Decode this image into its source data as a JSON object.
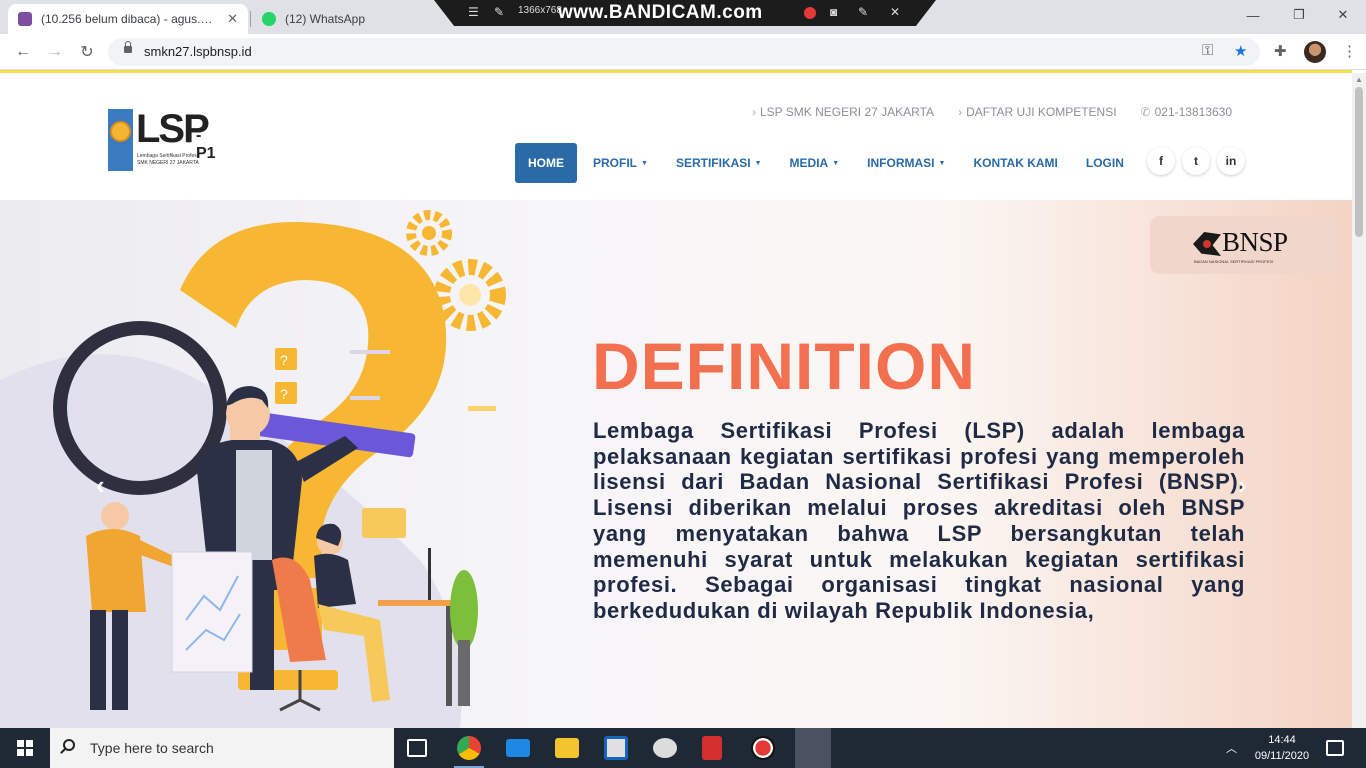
{
  "browser": {
    "tabs": [
      {
        "title": "(10.256 belum dibaca) - agus.sa:",
        "favicon_color": "#7b4ea3"
      },
      {
        "title": "(12) WhatsApp",
        "favicon_color": "#25d366"
      }
    ],
    "url": "smkn27.lspbnsp.id",
    "tab_close": "✕",
    "window_minimize": "—",
    "window_restore": "❐",
    "window_close": "✕"
  },
  "recorder": {
    "brand": "www.BANDICAM.com",
    "resolution": "1366x768"
  },
  "site": {
    "logo": {
      "main": "LSP",
      "suffix": "-P1",
      "line1": "Lembaga Sertifikasi Profesi",
      "line2": "SMK NEGERI 27 JAKARTA"
    },
    "top_links": [
      {
        "label": "LSP SMK NEGERI 27 JAKARTA",
        "icon": "chevron-right-icon"
      },
      {
        "label": "DAFTAR UJI KOMPETENSI",
        "icon": "chevron-right-icon"
      },
      {
        "label": "021-13813630",
        "icon": "phone-icon"
      }
    ],
    "nav": [
      {
        "label": "HOME",
        "dropdown": false,
        "active": true
      },
      {
        "label": "PROFIL",
        "dropdown": true
      },
      {
        "label": "SERTIFIKASI",
        "dropdown": true
      },
      {
        "label": "MEDIA",
        "dropdown": true
      },
      {
        "label": "INFORMASI",
        "dropdown": true
      },
      {
        "label": "KONTAK KAMI",
        "dropdown": false
      },
      {
        "label": "LOGIN",
        "dropdown": false
      }
    ],
    "social": [
      {
        "label": "f",
        "icon": "facebook-icon"
      },
      {
        "label": "t",
        "icon": "twitter-icon"
      },
      {
        "label": "in",
        "icon": "linkedin-icon"
      }
    ],
    "hero": {
      "badge_word": "BNSP",
      "badge_tagline": "BADAN NASIONAL SERTIFIKASI PROFESI",
      "title": "DEFINITION",
      "body": "Lembaga Sertifikasi Profesi (LSP) adalah lembaga pelaksanaan kegiatan sertifikasi profesi yang memperoleh lisensi dari Badan Nasional Sertifikasi Profesi (BNSP). Lisensi diberikan melalui proses akreditasi oleh BNSP yang menyatakan bahwa LSP bersangkutan telah memenuhi syarat untuk melakukan kegiatan sertifikasi profesi. Sebagai organisasi tingkat nasional yang berkedudukan di wilayah Republik Indonesia,",
      "prev_arrow": "‹",
      "next_arrow": "›"
    }
  },
  "taskbar": {
    "search_placeholder": "Type here to search",
    "time": "14:44",
    "date": "09/11/2020"
  },
  "colors": {
    "nav_blue": "#2a6aa6",
    "title_orange": "#f2704f",
    "body_navy": "#1f2a44",
    "taskbar": "#1f2936"
  }
}
